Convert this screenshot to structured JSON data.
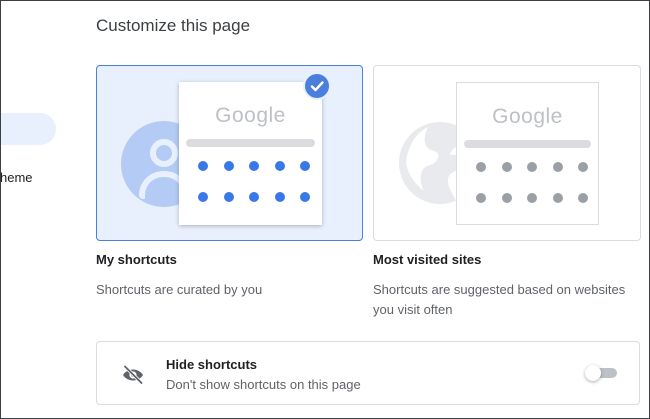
{
  "sidebar": {
    "partial_item_label": "heme"
  },
  "page_title": "Customize this page",
  "options": [
    {
      "id": "my-shortcuts",
      "title": "My shortcuts",
      "description": "Shortcuts are curated by you",
      "preview_logo": "Google",
      "selected": true,
      "icon": "avatar-icon"
    },
    {
      "id": "most-visited",
      "title": "Most visited sites",
      "description": "Shortcuts are suggested based on websites you visit often",
      "preview_logo": "Google",
      "selected": false,
      "icon": "globe-icon"
    }
  ],
  "hide_shortcuts": {
    "title": "Hide shortcuts",
    "description": "Don't show shortcuts on this page",
    "enabled": false,
    "icon": "eye-off-icon"
  },
  "colors": {
    "accent": "#4a7fdc",
    "selected_bg": "#e8f0fe",
    "dot_selected": "#3b78e7",
    "dot_unselected": "#9aa0a6"
  }
}
